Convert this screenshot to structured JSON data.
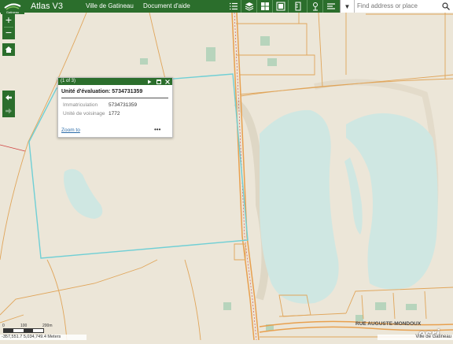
{
  "header": {
    "app_title": "Atlas V3",
    "links": [
      "Ville de Gatineau",
      "Document d'aide"
    ],
    "logo_text": "Gatineau",
    "tools": [
      "list-icon",
      "layers-icon",
      "grid-icon",
      "basemap-icon",
      "measure-icon",
      "location-icon",
      "draw-icon"
    ]
  },
  "search": {
    "placeholder": "Find address or place"
  },
  "popup": {
    "count": "(1 of 3)",
    "title": "Unité d'évaluation: 5734731359",
    "fields": [
      {
        "label": "Immatriculation",
        "value": "5734731359"
      },
      {
        "label": "Unité de voisinage",
        "value": "1772"
      }
    ],
    "zoom_link": "Zoom to",
    "more": "•••"
  },
  "map": {
    "street_label": "RUE AUGUSTE-MONDOUX",
    "scale_labels": [
      "0",
      "100",
      "200m"
    ],
    "coordinates": "-357,551.7 5,034,749.4 Meters",
    "attribution": "Ville de Gatineau",
    "basemap_logo": "esri",
    "colors": {
      "land": "#ece6d8",
      "water": "#cfe7e2",
      "road": "#e8a04e",
      "parcel": "#e0a55a",
      "selection": "#6fcfd5",
      "vegetation": "#b7d4bc",
      "header": "#2b6e2c"
    }
  }
}
